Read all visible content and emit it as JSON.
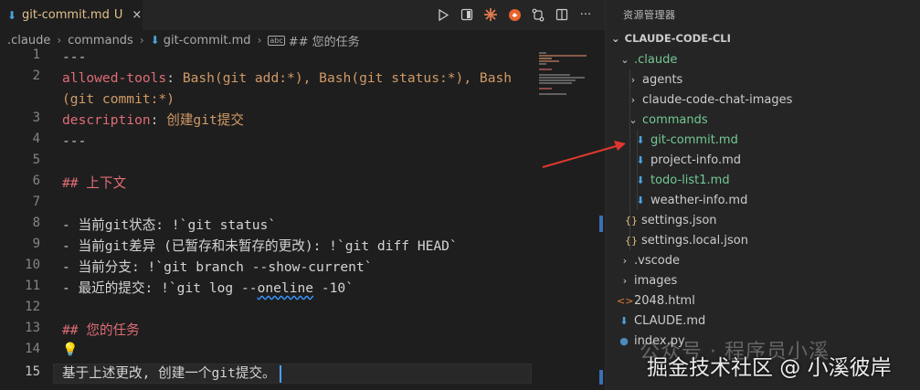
{
  "tab": {
    "icon": "markdown-icon",
    "label": "git-commit.md",
    "status": "U",
    "close": "×"
  },
  "toolbar_icons": [
    "play-icon",
    "preview-icon",
    "claude-icon",
    "extension-icon",
    "git-compare-icon",
    "split-editor-icon",
    "more-icon"
  ],
  "breadcrumb": [
    "claude",
    "commands",
    "git-commit.md",
    "## 您的任务"
  ],
  "breadcrumb_symbol": "abc",
  "line_numbers": [
    "1",
    "2",
    "",
    "3",
    "4",
    "5",
    "6",
    "7",
    "8",
    "9",
    "10",
    "11",
    "12",
    "13",
    "14",
    "15"
  ],
  "code": {
    "l1": "---",
    "l2_key": "allowed-tools",
    "l2_colon": ":",
    "l2_val": " Bash(git add:*), Bash(git status:*), Bash",
    "l2_val_wrap": "(git commit:*)",
    "l3_key": "description",
    "l3_colon": ":",
    "l3_val": " 创建git提交",
    "l4": "---",
    "l6": "## 上下文",
    "l8": "- 当前git状态: !`git status`",
    "l9": "- 当前git差异 (已暂存和未暂存的更改): !`git diff HEAD`",
    "l10": "- 当前分支: !`git branch --show-current`",
    "l11_pre": "- 最近的提交: !`git log --",
    "l11_wavy": "oneline",
    "l11_post": " -10`",
    "l13": "## 您的任务",
    "l14": "💡",
    "l15": "基于上述更改, 创建一个git提交。"
  },
  "explorer": {
    "title": "资源管理器",
    "root": "CLAUDE-CODE-CLI",
    "items": [
      {
        "label": ".claude",
        "chevron": "⌄",
        "icon": "",
        "color": "green"
      },
      {
        "label": "agents",
        "chevron": "›",
        "icon": "",
        "color": "default"
      },
      {
        "label": "claude-code-chat-images",
        "chevron": "›",
        "icon": "",
        "color": "default"
      },
      {
        "label": "commands",
        "chevron": "⌄",
        "icon": "",
        "color": "green"
      },
      {
        "label": "git-commit.md",
        "chevron": "",
        "icon": "markdown-icon",
        "color": "green"
      },
      {
        "label": "project-info.md",
        "chevron": "",
        "icon": "markdown-icon",
        "color": "default"
      },
      {
        "label": "todo-list1.md",
        "chevron": "",
        "icon": "markdown-icon",
        "color": "green"
      },
      {
        "label": "weather-info.md",
        "chevron": "",
        "icon": "markdown-icon",
        "color": "default"
      },
      {
        "label": "settings.json",
        "chevron": "",
        "icon": "json-icon",
        "color": "default"
      },
      {
        "label": "settings.local.json",
        "chevron": "",
        "icon": "json-icon",
        "color": "default"
      },
      {
        "label": ".vscode",
        "chevron": "›",
        "icon": "",
        "color": "default"
      },
      {
        "label": "images",
        "chevron": "›",
        "icon": "",
        "color": "default"
      },
      {
        "label": "2048.html",
        "chevron": "",
        "icon": "html-icon",
        "color": "default"
      },
      {
        "label": "CLAUDE.md",
        "chevron": "",
        "icon": "markdown-icon",
        "color": "default"
      },
      {
        "label": "index.py",
        "chevron": "",
        "icon": "python-icon",
        "color": "default"
      }
    ]
  },
  "watermark": {
    "faint": "公众号 · 程序员小溪",
    "main": "掘金技术社区 @ 小溪彼岸"
  },
  "colors": {
    "modified_green": "#73c991",
    "untracked_yellow": "#e2c08d",
    "annotation_arrow": "#e0382e"
  }
}
